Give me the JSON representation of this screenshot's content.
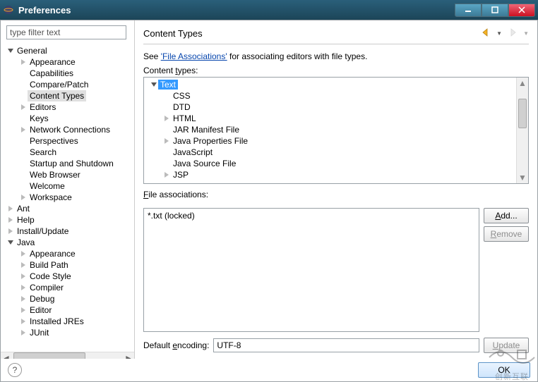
{
  "window": {
    "title": "Preferences"
  },
  "left": {
    "filter_placeholder": "type filter text",
    "tree": [
      {
        "label": "General",
        "depth": 0,
        "expander": "down",
        "selected": false
      },
      {
        "label": "Appearance",
        "depth": 1,
        "expander": "right",
        "selected": false
      },
      {
        "label": "Capabilities",
        "depth": 1,
        "expander": "none",
        "selected": false
      },
      {
        "label": "Compare/Patch",
        "depth": 1,
        "expander": "none",
        "selected": false
      },
      {
        "label": "Content Types",
        "depth": 1,
        "expander": "none",
        "selected": true
      },
      {
        "label": "Editors",
        "depth": 1,
        "expander": "right",
        "selected": false
      },
      {
        "label": "Keys",
        "depth": 1,
        "expander": "none",
        "selected": false
      },
      {
        "label": "Network Connections",
        "depth": 1,
        "expander": "right",
        "selected": false
      },
      {
        "label": "Perspectives",
        "depth": 1,
        "expander": "none",
        "selected": false
      },
      {
        "label": "Search",
        "depth": 1,
        "expander": "none",
        "selected": false
      },
      {
        "label": "Startup and Shutdown",
        "depth": 1,
        "expander": "none",
        "selected": false
      },
      {
        "label": "Web Browser",
        "depth": 1,
        "expander": "none",
        "selected": false
      },
      {
        "label": "Welcome",
        "depth": 1,
        "expander": "none",
        "selected": false
      },
      {
        "label": "Workspace",
        "depth": 1,
        "expander": "right",
        "selected": false
      },
      {
        "label": "Ant",
        "depth": 0,
        "expander": "right",
        "selected": false
      },
      {
        "label": "Help",
        "depth": 0,
        "expander": "right",
        "selected": false
      },
      {
        "label": "Install/Update",
        "depth": 0,
        "expander": "right",
        "selected": false
      },
      {
        "label": "Java",
        "depth": 0,
        "expander": "down",
        "selected": false
      },
      {
        "label": "Appearance",
        "depth": 1,
        "expander": "right",
        "selected": false
      },
      {
        "label": "Build Path",
        "depth": 1,
        "expander": "right",
        "selected": false
      },
      {
        "label": "Code Style",
        "depth": 1,
        "expander": "right",
        "selected": false
      },
      {
        "label": "Compiler",
        "depth": 1,
        "expander": "right",
        "selected": false
      },
      {
        "label": "Debug",
        "depth": 1,
        "expander": "right",
        "selected": false
      },
      {
        "label": "Editor",
        "depth": 1,
        "expander": "right",
        "selected": false
      },
      {
        "label": "Installed JREs",
        "depth": 1,
        "expander": "right",
        "selected": false
      },
      {
        "label": "JUnit",
        "depth": 1,
        "expander": "right",
        "selected": false
      }
    ]
  },
  "right": {
    "heading": "Content Types",
    "hint_prefix": "See ",
    "hint_link": "'File Associations'",
    "hint_suffix": " for associating editors with file types.",
    "content_types_label_pre": "Content ",
    "content_types_label_mn": "t",
    "content_types_label_post": "ypes:",
    "content_tree": [
      {
        "label": "Text",
        "depth": 0,
        "expander": "down",
        "highlighted": true
      },
      {
        "label": "CSS",
        "depth": 1,
        "expander": "none"
      },
      {
        "label": "DTD",
        "depth": 1,
        "expander": "none"
      },
      {
        "label": "HTML",
        "depth": 1,
        "expander": "right"
      },
      {
        "label": "JAR Manifest File",
        "depth": 1,
        "expander": "none"
      },
      {
        "label": "Java Properties File",
        "depth": 1,
        "expander": "right"
      },
      {
        "label": "JavaScript",
        "depth": 1,
        "expander": "none"
      },
      {
        "label": "Java Source File",
        "depth": 1,
        "expander": "none"
      },
      {
        "label": "JSP",
        "depth": 1,
        "expander": "right"
      }
    ],
    "file_assoc_label_mn": "F",
    "file_assoc_label_post": "ile associations:",
    "file_assoc_items": [
      "*.txt (locked)"
    ],
    "add_pre": "",
    "add_mn": "A",
    "add_post": "dd...",
    "remove_pre": "",
    "remove_mn": "R",
    "remove_post": "emove",
    "encoding_label_pre": "Default ",
    "encoding_label_mn": "e",
    "encoding_label_post": "ncoding:",
    "encoding_value": "UTF-8",
    "update_pre": "",
    "update_mn": "U",
    "update_post": "pdate"
  },
  "footer": {
    "ok": "OK"
  },
  "watermark": "创新互联"
}
